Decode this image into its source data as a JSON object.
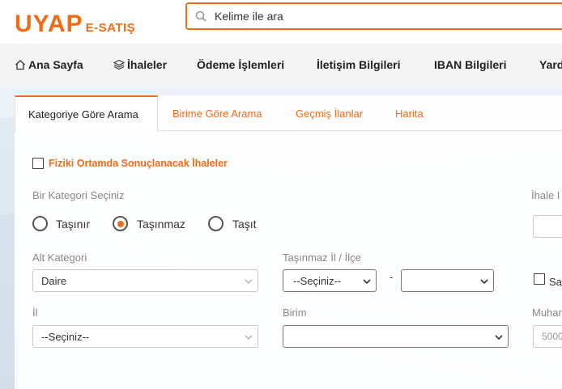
{
  "header": {
    "logo_main": "UYAP",
    "logo_sub": "E-SATIŞ",
    "search_placeholder": "Kelime ile ara"
  },
  "nav": {
    "items": [
      {
        "label": "Ana Sayfa",
        "icon": "home-icon"
      },
      {
        "label": "İhaleler",
        "icon": "layers-icon"
      },
      {
        "label": "Ödeme İşlemleri"
      },
      {
        "label": "İletişim Bilgileri"
      },
      {
        "label": "IBAN Bilgileri"
      },
      {
        "label": "Yard"
      }
    ]
  },
  "tabs": [
    {
      "label": "Kategoriye Göre Arama",
      "active": true
    },
    {
      "label": "Birime Göre Arama"
    },
    {
      "label": "Geçmiş İlanlar"
    },
    {
      "label": "Harita"
    }
  ],
  "form": {
    "physical_checkbox_label": "Fiziki Ortamda Sonuçlanacak İhaleler",
    "category_label": "Bir Kategori Seçiniz",
    "categories": [
      {
        "label": "Taşınır",
        "checked": false
      },
      {
        "label": "Taşınmaz",
        "checked": true
      },
      {
        "label": "Taşıt",
        "checked": false
      }
    ],
    "ihale_label": "İhale I",
    "alt_kategori_label": "Alt Kategori",
    "alt_kategori_value": "Daire",
    "il_ilce_label": "Taşınmaz İl / İlçe",
    "il_value": "--Seçiniz--",
    "ilce_value": "",
    "dash": "-",
    "sa_label": "Sa",
    "il_label": "İl",
    "il_select_value": "--Seçiniz--",
    "birim_label": "Birim",
    "birim_value": "",
    "muhan_label": "Muhan",
    "muhan_placeholder": "5000"
  },
  "colors": {
    "accent": "#ef6c17"
  }
}
